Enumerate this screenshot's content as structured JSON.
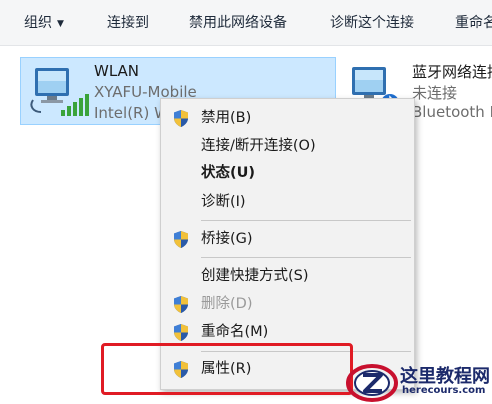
{
  "toolbar": {
    "organize": "组织",
    "connect_to": "连接到",
    "disable_device": "禁用此网络设备",
    "diagnose": "诊断这个连接",
    "rename": "重命名"
  },
  "adapters": [
    {
      "name": "WLAN",
      "network": "XYAFU-Mobile",
      "device": "Intel(R) W"
    },
    {
      "name": "蓝牙网络连接",
      "network": "未连接",
      "device": "Bluetooth D"
    }
  ],
  "menu": {
    "disable": "禁用(B)",
    "connect_disconnect": "连接/断开连接(O)",
    "status": "状态(U)",
    "diagnose": "诊断(I)",
    "bridge": "桥接(G)",
    "create_shortcut": "创建快捷方式(S)",
    "delete": "删除(D)",
    "rename": "重命名(M)",
    "properties": "属性(R)"
  },
  "watermark": {
    "title": "这里教程网",
    "url": "herecours.com"
  },
  "colors": {
    "selection": "#cce8ff",
    "highlight": "#e01b24",
    "menu_bg": "#f2f2f2"
  }
}
